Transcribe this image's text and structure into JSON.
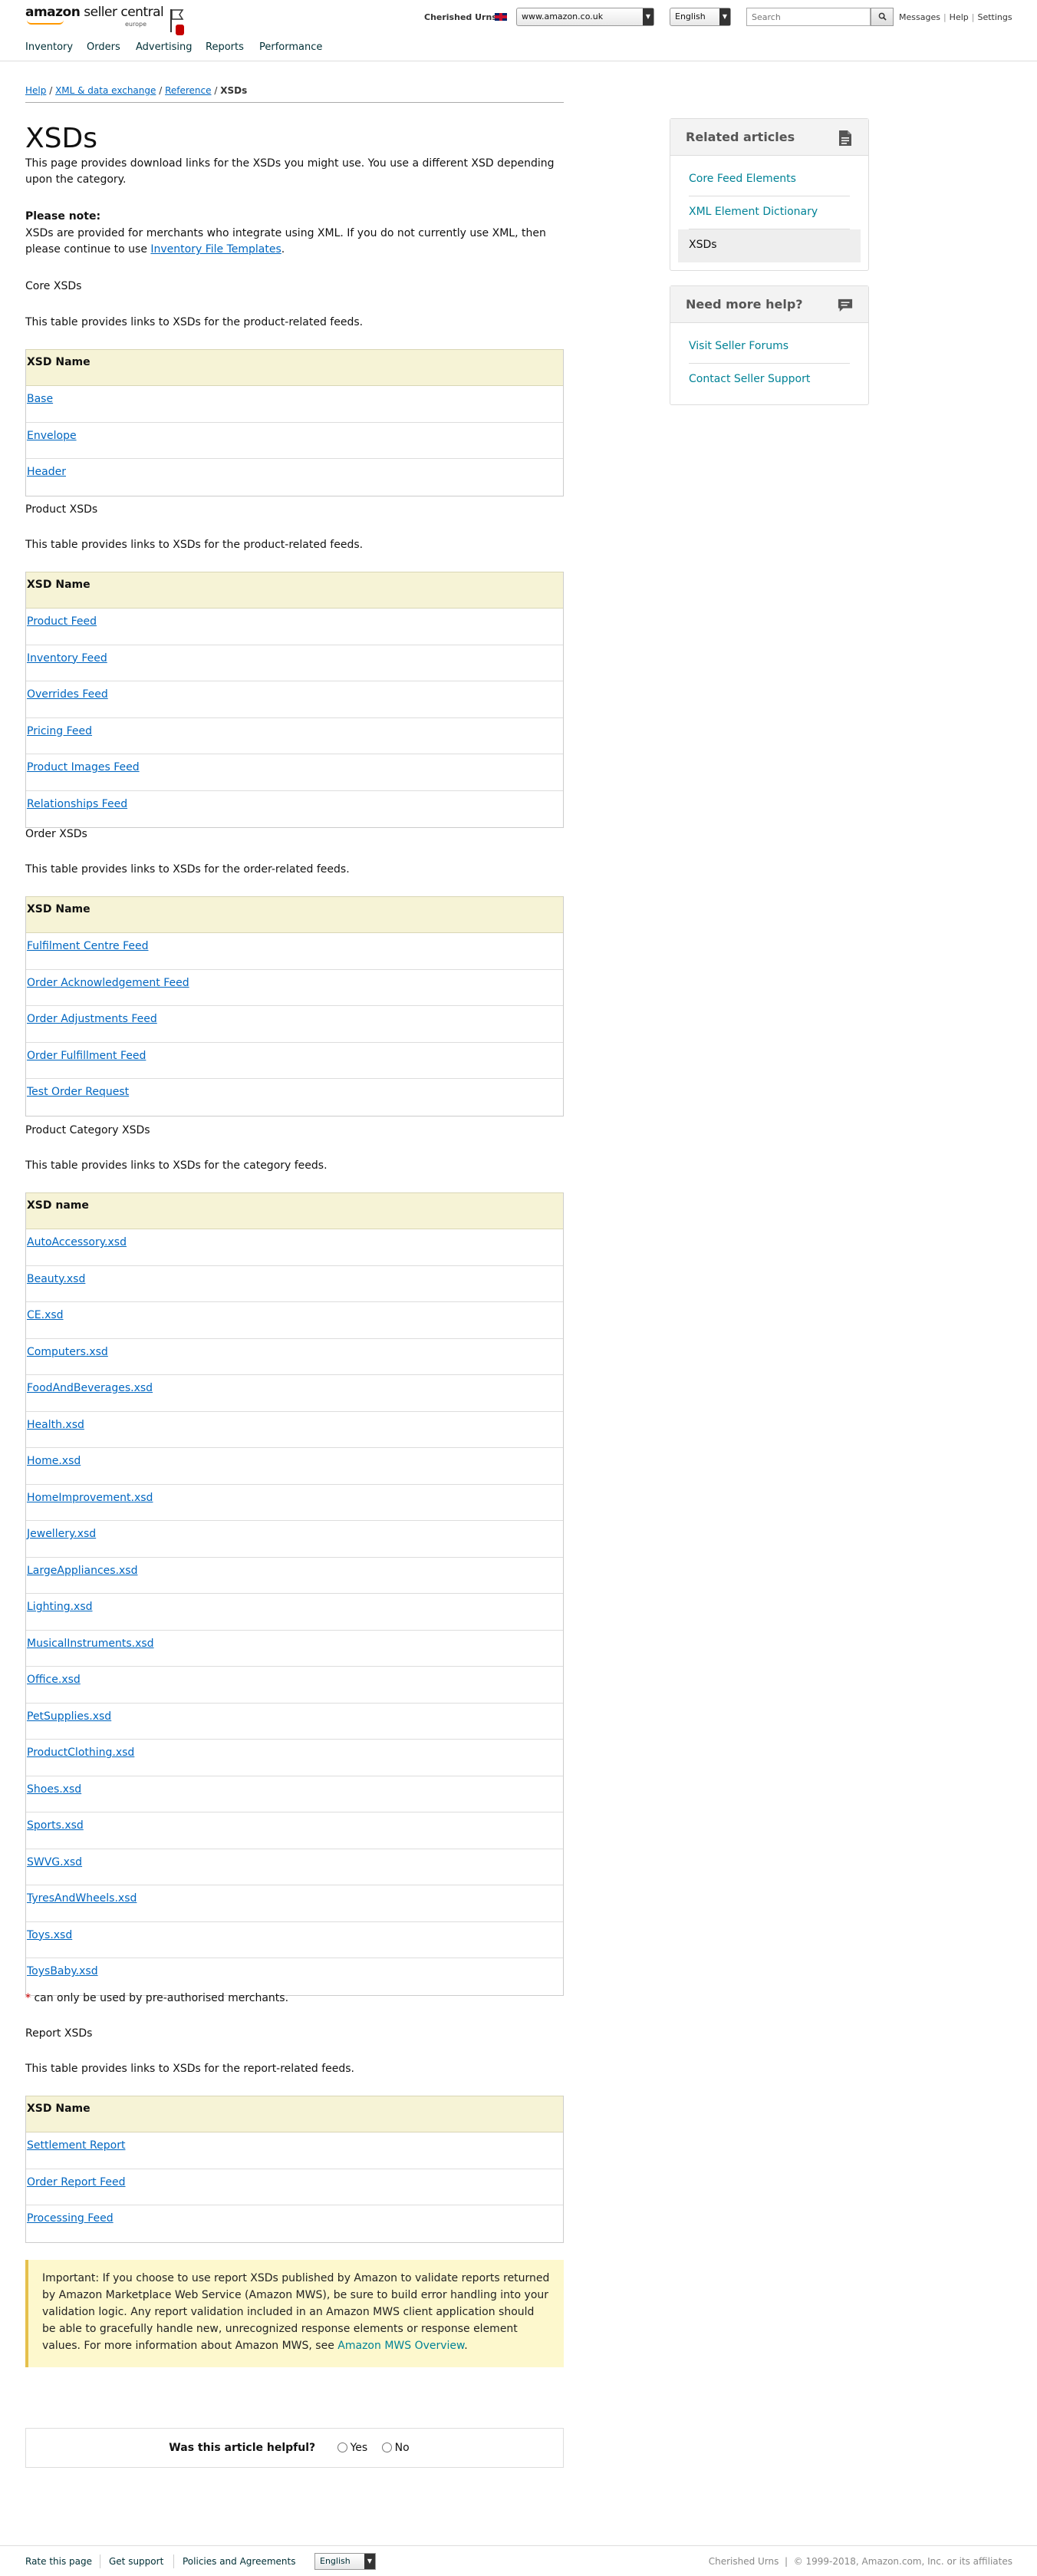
{
  "header": {
    "logo_main": "amazon",
    "logo_rest": " seller central",
    "logo_sub": "europe",
    "store_name": "Cherished Urns",
    "marketplace": "www.amazon.co.uk",
    "language": "English",
    "search_placeholder": "Search",
    "links": [
      "Messages",
      "Help",
      "Settings"
    ]
  },
  "nav": [
    "Inventory",
    "Orders",
    "Advertising",
    "Reports",
    "Performance"
  ],
  "breadcrumb": {
    "items": [
      "Help",
      "XML & data exchange",
      "Reference"
    ],
    "current": "XSDs",
    "sep": "/"
  },
  "page": {
    "title": "XSDs",
    "intro": "This page provides download links for the XSDs you might use. You use a different XSD depending upon the category.",
    "note_title": "Please note:",
    "note_body": "XSDs are provided for merchants who integrate using XML. If you do not currently use XML, then please continue to use ",
    "note_link": "Inventory File Templates",
    "note_end": "."
  },
  "sections": {
    "core": {
      "title": "Core XSDs",
      "desc": "This table provides links to XSDs for the product-related feeds.",
      "header": "XSD Name",
      "rows": [
        "Base",
        "Envelope",
        "Header"
      ]
    },
    "product": {
      "title": "Product XSDs",
      "desc": "This table provides links to XSDs for the product-related feeds.",
      "header": "XSD Name",
      "rows": [
        "Product Feed",
        "Inventory Feed",
        "Overrides Feed",
        "Pricing Feed",
        "Product Images Feed",
        "Relationships Feed"
      ]
    },
    "order": {
      "title": "Order XSDs",
      "desc": "This table provides links to XSDs for the order-related feeds.",
      "header": "XSD Name",
      "rows": [
        "Fulfilment Centre Feed",
        "Order Acknowledgement Feed",
        "Order Adjustments Feed",
        "Order Fulfillment Feed",
        "Test Order Request"
      ]
    },
    "category": {
      "title": "Product Category XSDs",
      "desc": "This table provides links to XSDs for the category feeds.",
      "header": "XSD name",
      "rows": [
        "AutoAccessory.xsd",
        "Beauty.xsd",
        "CE.xsd",
        "Computers.xsd",
        "FoodAndBeverages.xsd",
        "Health.xsd",
        "Home.xsd",
        "HomeImprovement.xsd",
        "Jewellery.xsd",
        "LargeAppliances.xsd",
        "Lighting.xsd",
        "MusicalInstruments.xsd",
        "Office.xsd",
        "PetSupplies.xsd",
        "ProductClothing.xsd",
        "Shoes.xsd",
        "Sports.xsd",
        "SWVG.xsd",
        "TyresAndWheels.xsd",
        "Toys.xsd",
        "ToysBaby.xsd"
      ]
    },
    "report": {
      "title": "Report XSDs",
      "desc": "This table provides links to XSDs for the report-related feeds.",
      "header": "XSD Name",
      "rows": [
        "Settlement Report",
        "Order Report Feed",
        "Processing Feed"
      ]
    }
  },
  "auth_note": {
    "star": "*",
    "text": " can only be used by pre-authorised merchants."
  },
  "important": {
    "text": "Important: If you choose to use report XSDs published by Amazon to validate reports returned by Amazon Marketplace Web Service (Amazon MWS), be sure to build error handling into your validation logic. Any report validation included in an Amazon MWS client application should be able to gracefully handle new, unrecognized response elements or response element values. For more information about Amazon MWS, see ",
    "link": "Amazon MWS Overview",
    "end": "."
  },
  "feedback": {
    "question": "Was this article helpful?",
    "yes": "Yes",
    "no": "No"
  },
  "sidebar": {
    "related_title": "Related articles",
    "related": [
      "Core Feed Elements",
      "XML Element Dictionary",
      "XSDs"
    ],
    "help_title": "Need more help?",
    "help": [
      "Visit Seller Forums",
      "Contact Seller Support"
    ]
  },
  "footer": {
    "links": [
      "Rate this page",
      "Get support",
      "Policies and Agreements"
    ],
    "language": "English",
    "store": "Cherished Urns",
    "copyright": "© 1999-2018, Amazon.com, Inc. or its affiliates"
  },
  "colors": {
    "link": "#0066c0",
    "teal": "#008296",
    "table_header": "#f6f3d6",
    "important_bg": "#fdf8cd"
  }
}
